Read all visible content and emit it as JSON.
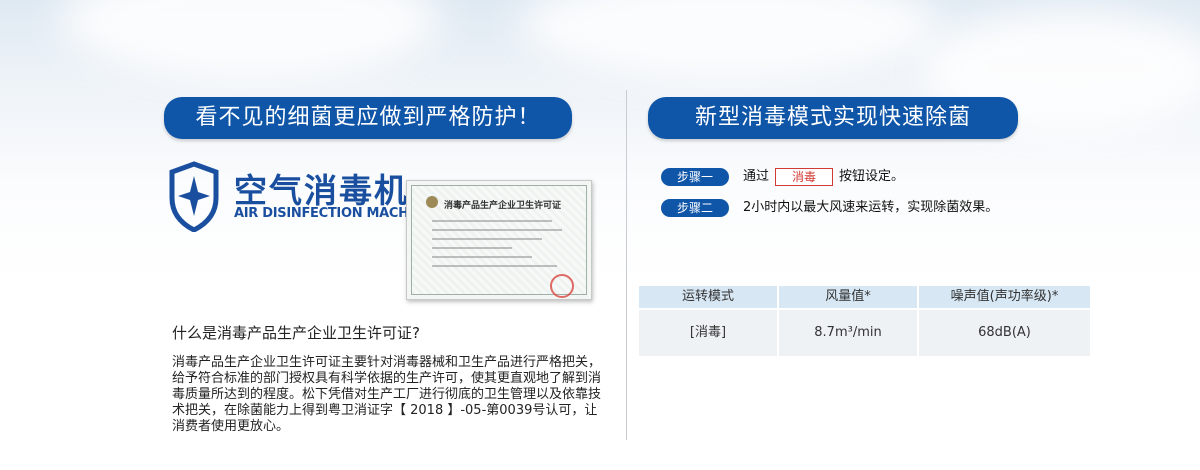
{
  "left": {
    "heading": "看不见的细菌更应做到严格防护！",
    "logo": {
      "title_cn": "空气消毒机",
      "title_en": "AIR DISINFECTION MACHINE"
    },
    "certificate": {
      "title": "消毒产品生产企业卫生许可证"
    },
    "question": "什么是消毒产品生产企业卫生许可证?",
    "description": "消毒产品生产企业卫生许可证主要针对消毒器械和卫生产品进行严格把关，给予符合标准的部门授权具有科学依据的生产许可，使其更直观地了解到消毒质量所达到的程度。松下凭借对生产工厂进行彻底的卫生管理以及依靠技术把关，在除菌能力上得到粤卫消证字【 2018 】-05-第0039号认可，让消费者使用更放心。"
  },
  "right": {
    "heading": "新型消毒模式实现快速除菌",
    "steps": [
      {
        "badge": "步骤一",
        "prefix": "通过",
        "button_label": "消毒",
        "suffix": "按钮设定。"
      },
      {
        "badge": "步骤二",
        "text": "2小时内以最大风速来运转，实现除菌效果。"
      }
    ],
    "table": {
      "headers": [
        "运转模式",
        "风量值*",
        "噪声值(声功率级)*"
      ],
      "row": [
        "[消毒]",
        "8.7m³/min",
        "68dB(A)"
      ]
    }
  },
  "colors": {
    "brand_blue": "#0f56a8",
    "accent_red": "#d23b33"
  }
}
